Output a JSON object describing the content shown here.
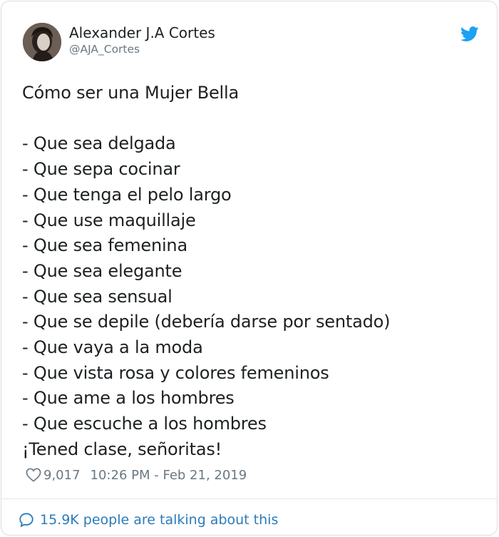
{
  "author": {
    "name": "Alexander J.A Cortes",
    "handle": "@AJA_Cortes"
  },
  "tweet": {
    "lines": [
      "Cómo ser una Mujer Bella",
      "",
      "- Que sea delgada",
      "- Que sepa cocinar",
      "- Que tenga el pelo largo",
      "- Que use maquillaje",
      "- Que sea femenina",
      "- Que sea elegante",
      "- Que sea sensual",
      "- Que se depile (debería darse por sentado)",
      "- Que vaya a la moda",
      "- Que vista rosa y colores femeninos",
      "- Que ame a los hombres",
      "- Que escuche a los hombres",
      "¡Tened clase, señoritas!"
    ]
  },
  "meta": {
    "likes": "9,017",
    "timestamp": "10:26 PM - Feb 21, 2019"
  },
  "footer": {
    "talking": "15.9K people are talking about this"
  },
  "icons": {
    "brand": "twitter-bird-icon",
    "like": "heart-icon",
    "reply": "speech-bubble-icon"
  },
  "colors": {
    "twitter_blue": "#1da1f2",
    "link_blue": "#2b7bb9",
    "muted_gray": "#697882"
  }
}
